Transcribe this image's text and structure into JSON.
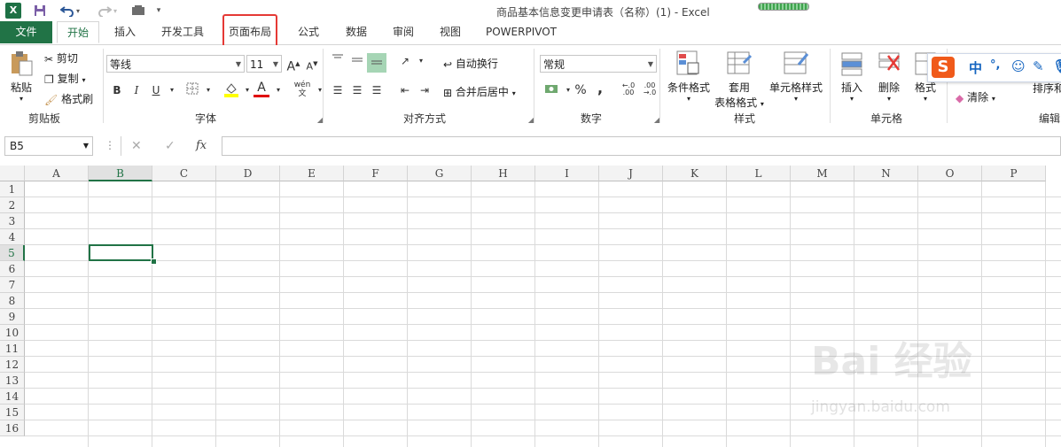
{
  "window": {
    "title": "商品基本信息变更申请表（名称）(1) - Excel"
  },
  "tabs": [
    {
      "id": "file",
      "label": "文件"
    },
    {
      "id": "home",
      "label": "开始"
    },
    {
      "id": "insert",
      "label": "插入"
    },
    {
      "id": "developer",
      "label": "开发工具"
    },
    {
      "id": "page_layout",
      "label": "页面布局"
    },
    {
      "id": "formulas",
      "label": "公式"
    },
    {
      "id": "data",
      "label": "数据"
    },
    {
      "id": "review",
      "label": "审阅"
    },
    {
      "id": "view",
      "label": "视图"
    },
    {
      "id": "powerpivot",
      "label": "POWERPIVOT"
    }
  ],
  "clipboard": {
    "paste": "粘贴",
    "cut": "剪切",
    "copy": "复制",
    "format_painter": "格式刷",
    "group": "剪贴板"
  },
  "font": {
    "name": "等线",
    "size": "11",
    "bold": "B",
    "italic": "I",
    "underline": "U",
    "grow": "A",
    "shrink": "A",
    "font_color": "A",
    "wen": "wén",
    "group": "字体"
  },
  "alignment": {
    "wrap": "自动换行",
    "merge": "合并后居中",
    "group": "对齐方式"
  },
  "number": {
    "format": "常规",
    "percent": "%",
    "comma": ",",
    "group": "数字"
  },
  "styles": {
    "conditional": "条件格式",
    "table_format_1": "套用",
    "table_format_2": "表格格式",
    "cell_styles": "单元格样式",
    "group": "样式"
  },
  "cells": {
    "insert": "插入",
    "delete": "删除",
    "format": "格式",
    "group": "单元格"
  },
  "editing": {
    "clear": "清除",
    "sort": "排序和",
    "group": "编辑"
  },
  "ime": {
    "logo": "S",
    "lang": "中",
    "punct": "°,"
  },
  "formula_bar": {
    "name_box": "B5",
    "cancel": "✕",
    "enter": "✓",
    "fx": "fx"
  },
  "sheet": {
    "columns": [
      "A",
      "B",
      "C",
      "D",
      "E",
      "F",
      "G",
      "H",
      "I",
      "J",
      "K",
      "L",
      "M",
      "N",
      "O",
      "P"
    ],
    "rows": [
      "1",
      "2",
      "3",
      "4",
      "5",
      "6",
      "7",
      "8",
      "9",
      "10",
      "11",
      "12",
      "13",
      "14",
      "15",
      "16"
    ],
    "active_cell": "B5"
  },
  "watermark": {
    "brand": "Bai 经验",
    "url": "jingyan.baidu.com"
  }
}
